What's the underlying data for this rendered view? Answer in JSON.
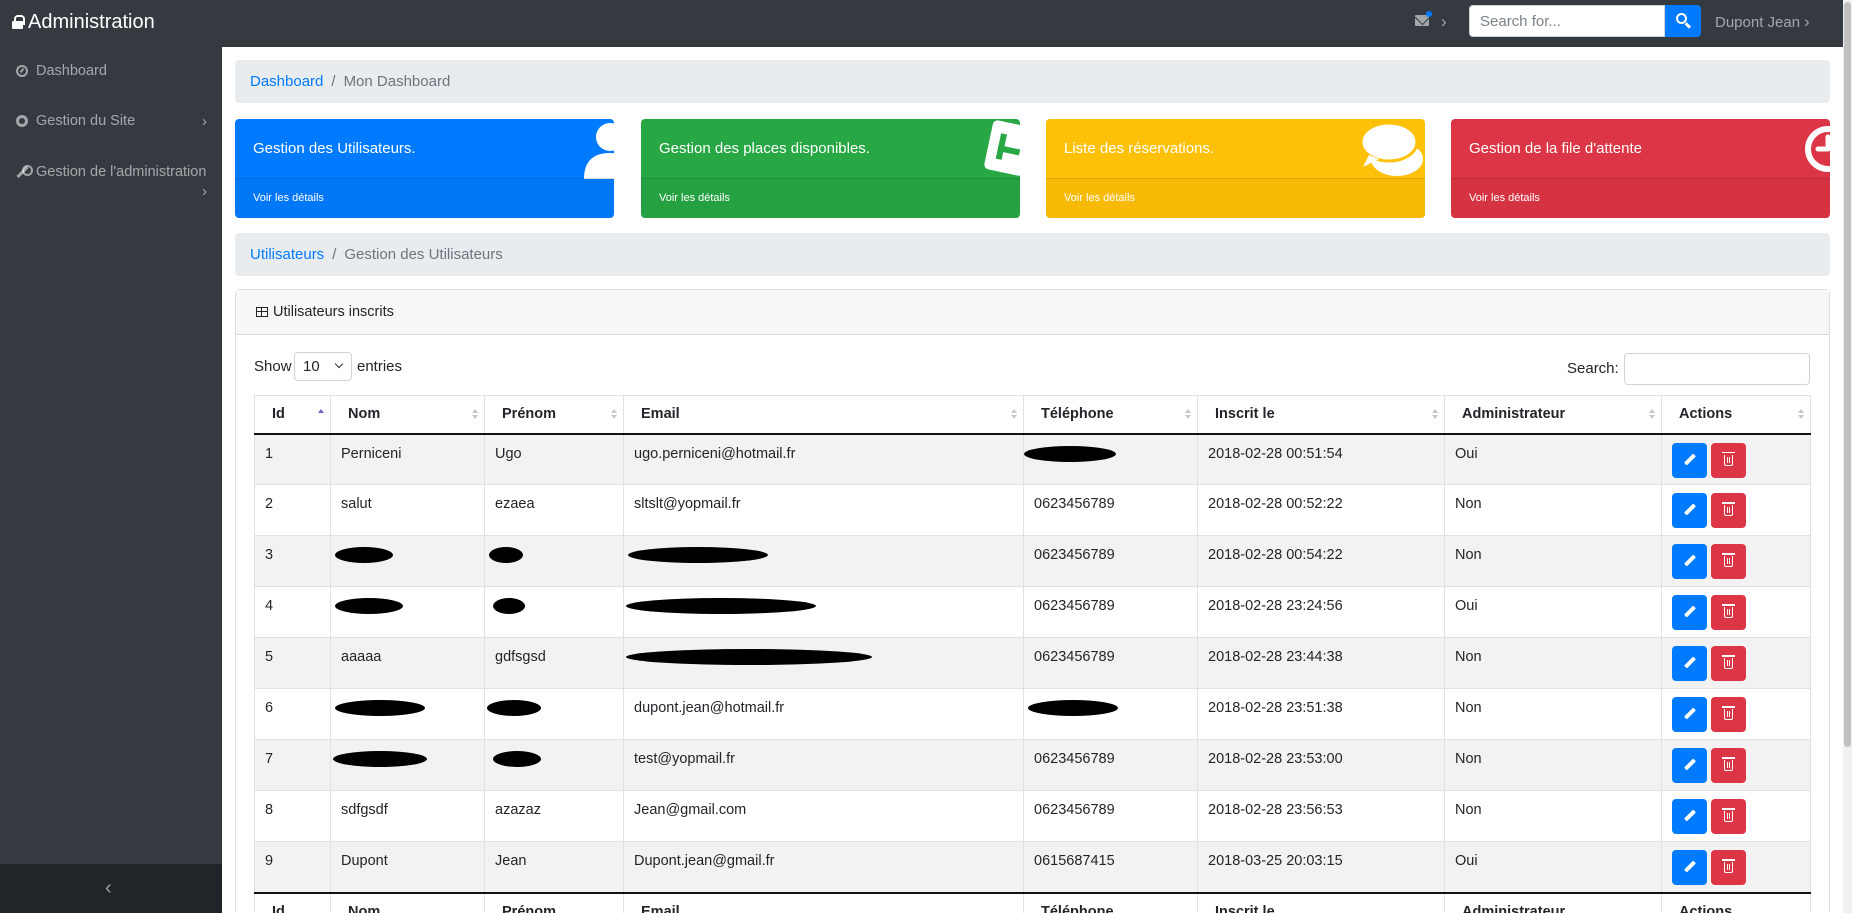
{
  "app": {
    "title": "Administration"
  },
  "topbar": {
    "search_placeholder": "Search for...",
    "user_name": "Dupont Jean"
  },
  "sidebar": {
    "items": [
      {
        "label": "Dashboard",
        "icon": "dashboard-icon"
      },
      {
        "label": "Gestion du Site",
        "icon": "gear-icon"
      },
      {
        "label": "Gestion de l'administration",
        "icon": "wrench-icon"
      }
    ],
    "toggle": "‹"
  },
  "breadcrumb1": {
    "link": "Dashboard",
    "active": "Mon Dashboard"
  },
  "cards": [
    {
      "title": "Gestion des Utilisateurs.",
      "footer": "Voir les détails",
      "color": "#007bff",
      "icon": "user-icon"
    },
    {
      "title": "Gestion des places disponibles.",
      "footer": "Voir les détails",
      "color": "#28a745",
      "icon": "parking-icon"
    },
    {
      "title": "Liste des réservations.",
      "footer": "Voir les détails",
      "color": "#ffc107",
      "icon": "comments-icon"
    },
    {
      "title": "Gestion de la file d'attente",
      "footer": "Voir les détails",
      "color": "#dc3545",
      "icon": "clock-icon"
    }
  ],
  "breadcrumb2": {
    "link": "Utilisateurs",
    "active": "Gestion des Utilisateurs"
  },
  "panel": {
    "title": "Utilisateurs inscrits",
    "show_label": "Show",
    "entries_value": "10",
    "entries_label": "entries",
    "search_label": "Search:"
  },
  "table": {
    "columns": [
      "Id",
      "Nom",
      "Prénom",
      "Email",
      "Téléphone",
      "Inscrit le",
      "Administrateur",
      "Actions"
    ],
    "rows": [
      {
        "id": "1",
        "nom": "Perniceni",
        "prenom": "Ugo",
        "email": "ugo.perniceni@hotmail.fr",
        "telephone": "",
        "inscrit": "2018-02-28 00:51:54",
        "admin": "Oui"
      },
      {
        "id": "2",
        "nom": "salut",
        "prenom": "ezaea",
        "email": "sltslt@yopmail.fr",
        "telephone": "0623456789",
        "inscrit": "2018-02-28 00:52:22",
        "admin": "Non"
      },
      {
        "id": "3",
        "nom": "",
        "prenom": "",
        "email": "",
        "telephone": "0623456789",
        "inscrit": "2018-02-28 00:54:22",
        "admin": "Non"
      },
      {
        "id": "4",
        "nom": "",
        "prenom": "",
        "email": "",
        "telephone": "0623456789",
        "inscrit": "2018-02-28 23:24:56",
        "admin": "Oui"
      },
      {
        "id": "5",
        "nom": "aaaaa",
        "prenom": "gdfsgsd",
        "email": "",
        "telephone": "0623456789",
        "inscrit": "2018-02-28 23:44:38",
        "admin": "Non"
      },
      {
        "id": "6",
        "nom": "",
        "prenom": "",
        "email": "dupont.jean@hotmail.fr",
        "telephone": "",
        "inscrit": "2018-02-28 23:51:38",
        "admin": "Non"
      },
      {
        "id": "7",
        "nom": "",
        "prenom": "",
        "email": "test@yopmail.fr",
        "telephone": "0623456789",
        "inscrit": "2018-02-28 23:53:00",
        "admin": "Non"
      },
      {
        "id": "8",
        "nom": "sdfgsdf",
        "prenom": "azazaz",
        "email": "Jean@gmail.com",
        "telephone": "0623456789",
        "inscrit": "2018-02-28 23:56:53",
        "admin": "Non"
      },
      {
        "id": "9",
        "nom": "Dupont",
        "prenom": "Jean",
        "email": "Dupont.jean@gmail.fr",
        "telephone": "0615687415",
        "inscrit": "2018-03-25 20:03:15",
        "admin": "Oui"
      }
    ]
  }
}
